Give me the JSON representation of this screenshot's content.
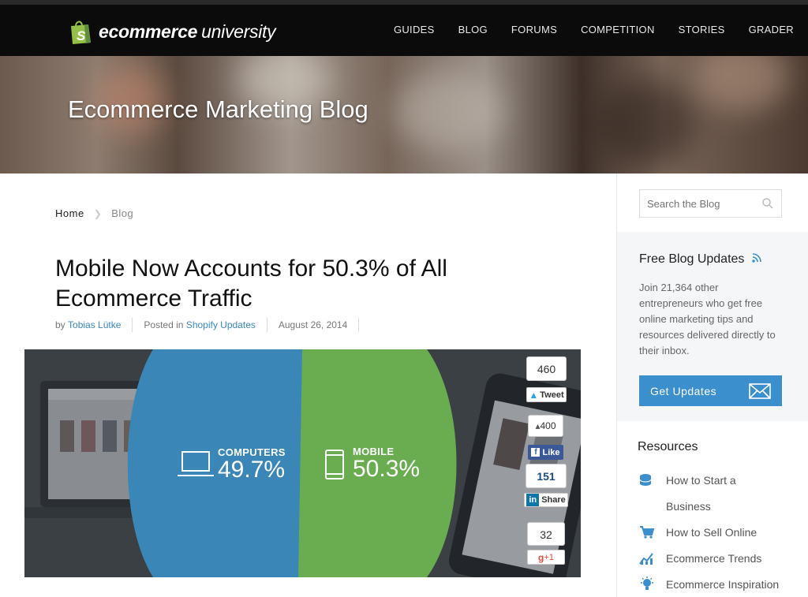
{
  "header": {
    "logo_bold": "ecommerce",
    "logo_light": "university",
    "nav": [
      "GUIDES",
      "BLOG",
      "FORUMS",
      "COMPETITION",
      "STORIES",
      "GRADER"
    ]
  },
  "hero": {
    "title": "Ecommerce Marketing Blog"
  },
  "breadcrumb": {
    "home": "Home",
    "current": "Blog"
  },
  "post": {
    "title": "Mobile Now Accounts for 50.3% of All Ecommerce Traffic",
    "by_label": "by",
    "author": "Tobias Lütke",
    "posted_label": "Posted in",
    "category": "Shopify Updates",
    "date": "August 26, 2014"
  },
  "feature": {
    "left_label": "COMPUTERS",
    "left_pct": "49.7%",
    "right_label": "MOBILE",
    "right_pct": "50.3%",
    "left_color": "#3a87b7",
    "right_color": "#6aac50"
  },
  "share": {
    "twitter_count": "460",
    "twitter_label": "Tweet",
    "facebook_count": "400",
    "facebook_label": "Like",
    "linkedin_count": "151",
    "linkedin_label": "Share",
    "gplus_count": "32",
    "gplus_label": "+1"
  },
  "sidebar": {
    "search_placeholder": "Search the Blog",
    "updates_title": "Free Blog Updates",
    "updates_text": "Join 21,364 other entrepreneurs who get free online marketing tips and resources delivered directly to their inbox.",
    "updates_button": "Get Updates",
    "resources_title": "Resources",
    "resources": [
      {
        "label": "How to Start a Business",
        "icon": "coins-icon"
      },
      {
        "label": "How to Sell Online",
        "icon": "cart-icon"
      },
      {
        "label": "Ecommerce Trends",
        "icon": "chart-icon"
      },
      {
        "label": "Ecommerce Inspiration",
        "icon": "lightbulb-icon"
      }
    ]
  },
  "colors": {
    "accent": "#3a8fcc",
    "link": "#3a87c4",
    "topbar": "#0b0b0b"
  }
}
